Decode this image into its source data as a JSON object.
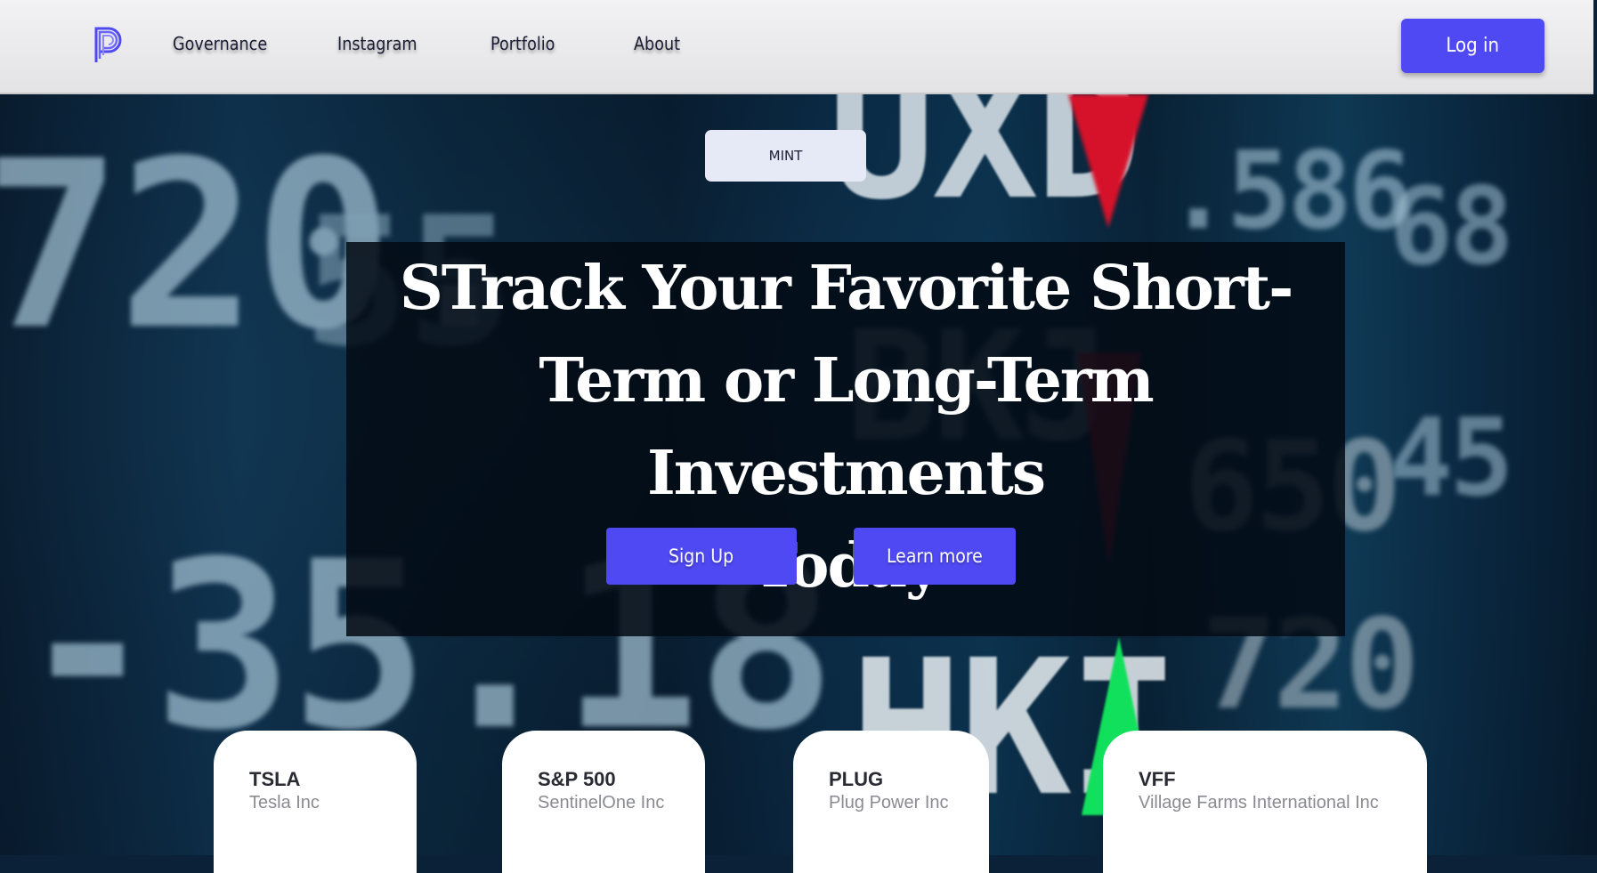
{
  "nav": {
    "logo_icon": "p-logo-icon",
    "links": [
      {
        "label": "Governance"
      },
      {
        "label": "Instagram"
      },
      {
        "label": "Portfolio"
      },
      {
        "label": "About"
      }
    ],
    "login_label": "Log in"
  },
  "hero": {
    "mint_label": "MINT",
    "headline_line1": "STrack Your Favorite Short-",
    "headline_line2": "Term or Long-Term Investments",
    "headline_line3": "Today",
    "signup_label": "Sign Up",
    "learn_more_label": "Learn more"
  },
  "stocks": [
    {
      "symbol": "TSLA",
      "name": "Tesla Inc"
    },
    {
      "symbol": "S&P 500",
      "name": "SentinelOne Inc"
    },
    {
      "symbol": "PLUG",
      "name": "Plug Power Inc"
    },
    {
      "symbol": "VFF",
      "name": "Village Farms International Inc"
    }
  ],
  "colors": {
    "accent": "#4f49f4",
    "nav_bg": "#ececee",
    "panel_bg": "#020a14",
    "card_bg": "#ffffff"
  }
}
